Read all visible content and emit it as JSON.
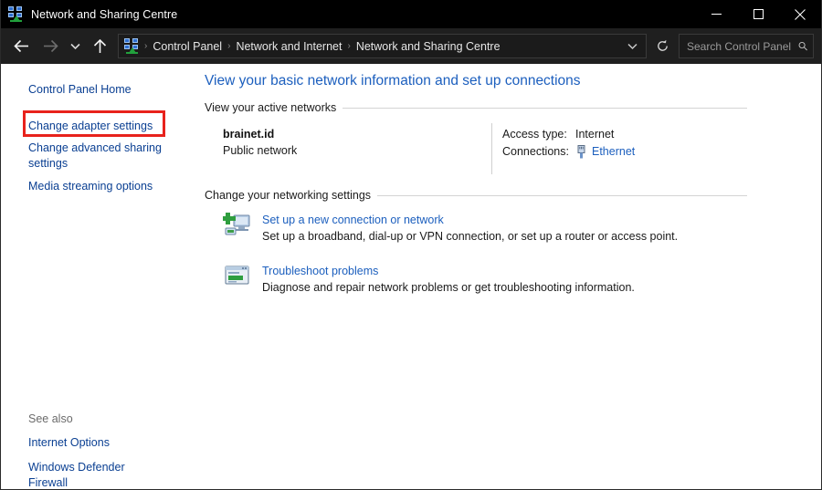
{
  "window": {
    "title": "Network and Sharing Centre",
    "app_icon": "network-computers-icon",
    "controls": {
      "minimize": "minimize-button",
      "maximize": "maximize-button",
      "close": "close-button"
    }
  },
  "navbar": {
    "back": "back-arrow-icon",
    "forward": "forward-arrow-icon",
    "recent": "chevron-down-icon",
    "up": "up-arrow-icon",
    "breadcrumb_icon": "network-computers-icon",
    "breadcrumb": [
      "Control Panel",
      "Network and Internet",
      "Network and Sharing Centre"
    ],
    "breadcrumb_separator": "›",
    "dropdown": "chevron-down-icon",
    "refresh": "refresh-icon",
    "search": {
      "placeholder": "Search Control Panel",
      "value": "",
      "icon": "search-icon"
    }
  },
  "sidebar": {
    "items": [
      {
        "label": "Control Panel Home",
        "highlighted": false
      },
      {
        "label": "Change adapter settings",
        "highlighted": true
      },
      {
        "label": "Change advanced sharing settings",
        "highlighted": false
      },
      {
        "label": "Media streaming options",
        "highlighted": false
      }
    ],
    "see_also": {
      "title": "See also",
      "items": [
        {
          "label": "Internet Options"
        },
        {
          "label": "Windows Defender Firewall"
        }
      ]
    },
    "highlight_color": "#e8221c"
  },
  "main": {
    "heading": "View your basic network information and set up connections",
    "sections": [
      {
        "id": "active",
        "title": "View your active networks"
      },
      {
        "id": "change",
        "title": "Change your networking settings"
      }
    ],
    "active_network": {
      "name": "brainet.id",
      "type": "Public network",
      "details": [
        {
          "label": "Access type:",
          "value": "Internet",
          "is_link": false,
          "icon": ""
        },
        {
          "label": "Connections:",
          "value": "Ethernet",
          "is_link": true,
          "icon": "ethernet-plug-icon"
        }
      ]
    },
    "networking_settings": [
      {
        "icon": "new-connection-icon",
        "link": "Set up a new connection or network",
        "description": "Set up a broadband, dial-up or VPN connection, or set up a router or access point."
      },
      {
        "icon": "troubleshoot-icon",
        "link": "Troubleshoot problems",
        "description": "Diagnose and repair network problems or get troubleshooting information."
      }
    ]
  },
  "colors": {
    "titlebar_bg": "#000000",
    "navbar_bg": "#1f1f1f",
    "content_bg": "#ffffff",
    "link": "#1c5fbe",
    "sidebar_link": "#0a3f92",
    "heading": "#1c5fbe",
    "highlight": "#e8221c"
  }
}
